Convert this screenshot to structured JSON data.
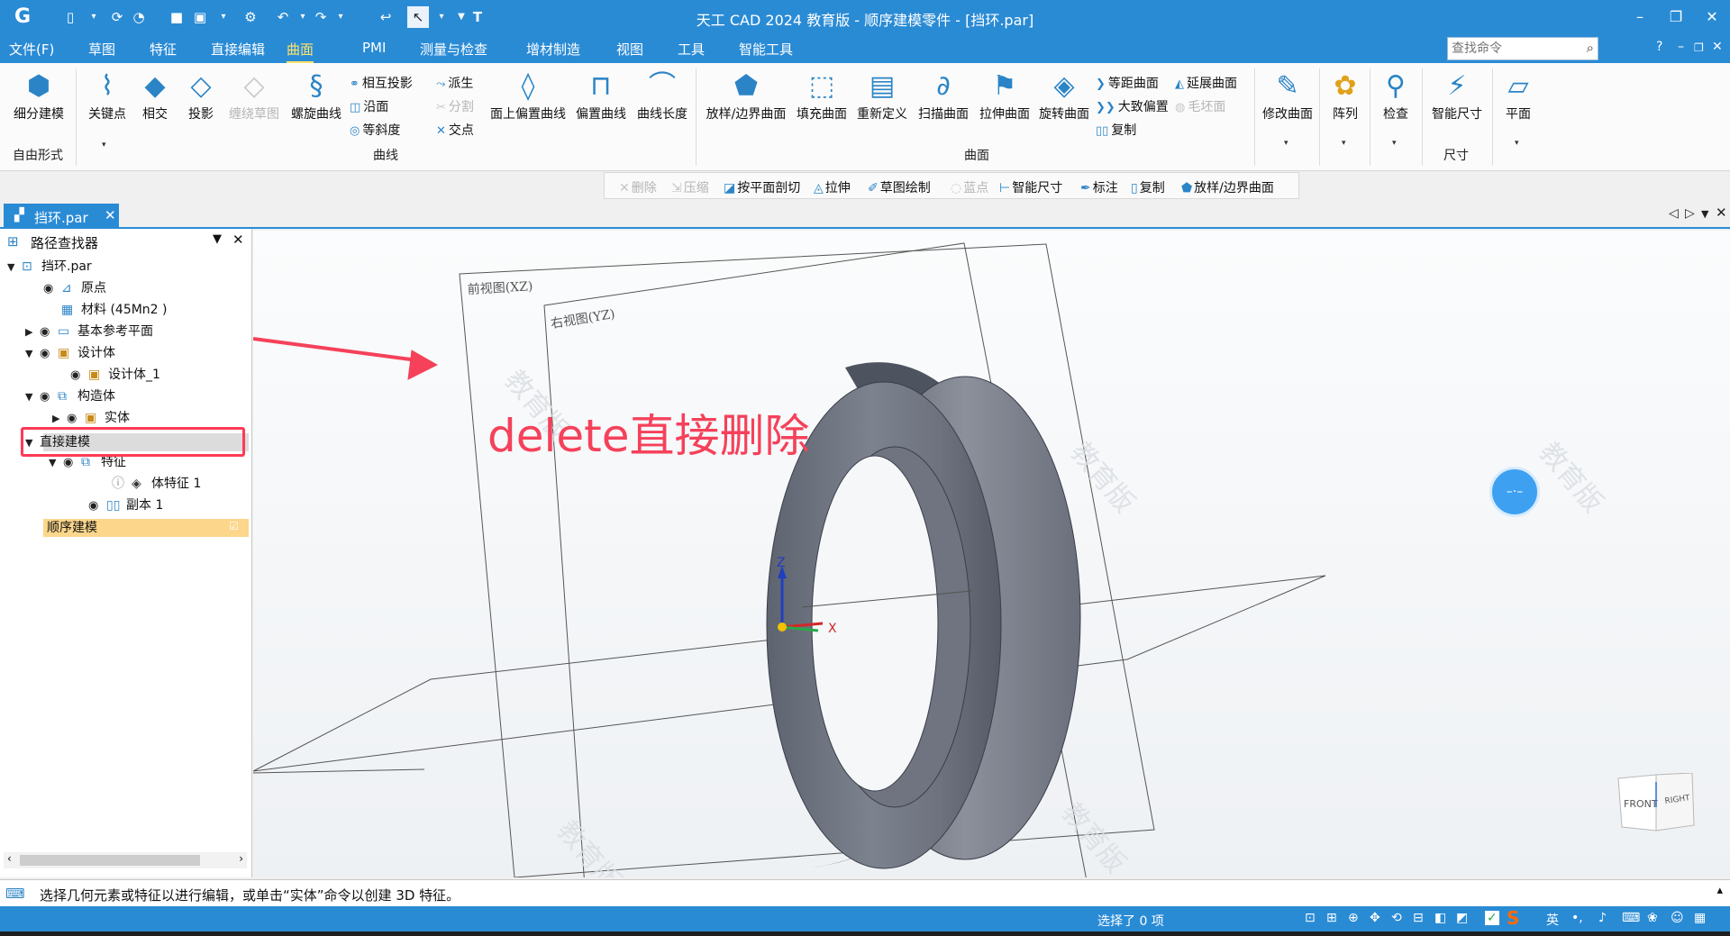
{
  "app": {
    "window_title": "天工 CAD 2024 教育版 - 顺序建模零件 - [挡环.par]"
  },
  "quick_access": [
    "new-icon",
    "open-icon",
    "save-icon",
    "undo-icon",
    "redo-icon",
    "select-icon"
  ],
  "menu": {
    "items": [
      "文件(F)",
      "草图",
      "特征",
      "直接编辑",
      "曲面",
      "PMI",
      "测量与检查",
      "增材制造",
      "视图",
      "工具",
      "智能工具"
    ],
    "active": "曲面",
    "search_placeholder": "查找命令",
    "help": "?"
  },
  "ribbon": {
    "freeform": {
      "refine": "细分建模",
      "group": "自由形式"
    },
    "curve": {
      "keypoint": "关键点",
      "intersect": "相交",
      "project": "投影",
      "wrap_sketch": "缠绕草图",
      "helix": "螺旋曲线",
      "mutual_project": "相互投影",
      "along_face": "沿面",
      "isocline": "等斜度",
      "derive": "派生",
      "split": "分割",
      "intersection_point": "交点",
      "offset_on_face": "面上偏置曲线",
      "offset_curve": "偏置曲线",
      "curve_length": "曲线长度",
      "group": "曲线"
    },
    "surface": {
      "loft_bounded": "放样/边界曲面",
      "fill": "填充曲面",
      "redefine": "重新定义",
      "sweep": "扫描曲面",
      "extrude": "拉伸曲面",
      "revolve": "旋转曲面",
      "equidistant": "等距曲面",
      "extend": "延展曲面",
      "rough_offset": "大致偏置",
      "blank": "毛坯面",
      "copy": "复制",
      "group": "曲面"
    },
    "modify": "修改曲面",
    "array": "阵列",
    "check": "检查",
    "smart_dim": "智能尺寸",
    "plane": "平面",
    "dim_group": "尺寸"
  },
  "command_bar": {
    "delete": "删除",
    "compress": "压缩",
    "section": "按平面剖切",
    "extrude": "拉伸",
    "sketch": "草图绘制",
    "blue_point": "蓝点",
    "smart_dim": "智能尺寸",
    "annotate": "标注",
    "copy": "复制",
    "loft": "放样/边界曲面"
  },
  "doc_tab": {
    "name": "挡环.par"
  },
  "pathfinder": {
    "title": "路径查找器",
    "root": "挡环.par",
    "origin": "原点",
    "material": "材料 (45Mn2 )",
    "ref_planes": "基本参考平面",
    "design_body": "设计体",
    "design_body_1": "设计体_1",
    "construction": "构造体",
    "solid": "实体",
    "direct_modeling": "直接建模",
    "features": "特征",
    "body_feature": "体特征 1",
    "copy1": "副本 1",
    "ordered_modeling": "顺序建模"
  },
  "viewport": {
    "front_plane": "前视图(XZ)",
    "right_plane": "右视图(YZ)",
    "annotation": "delete直接删除",
    "axis_z": "Z",
    "axis_x": "X",
    "watermark": "教育版",
    "cube_front": "FRONT",
    "cube_right": "RIGHT"
  },
  "prompt": "选择几何元素或特征以进行编辑，或单击“实体”命令以创建 3D 特征。",
  "status": {
    "selection": "选择了 0 项",
    "ime": "英"
  },
  "colors": {
    "accent": "#2a8bd5",
    "annotation": "#f5415a",
    "ordered_bg": "#fcd68b"
  }
}
